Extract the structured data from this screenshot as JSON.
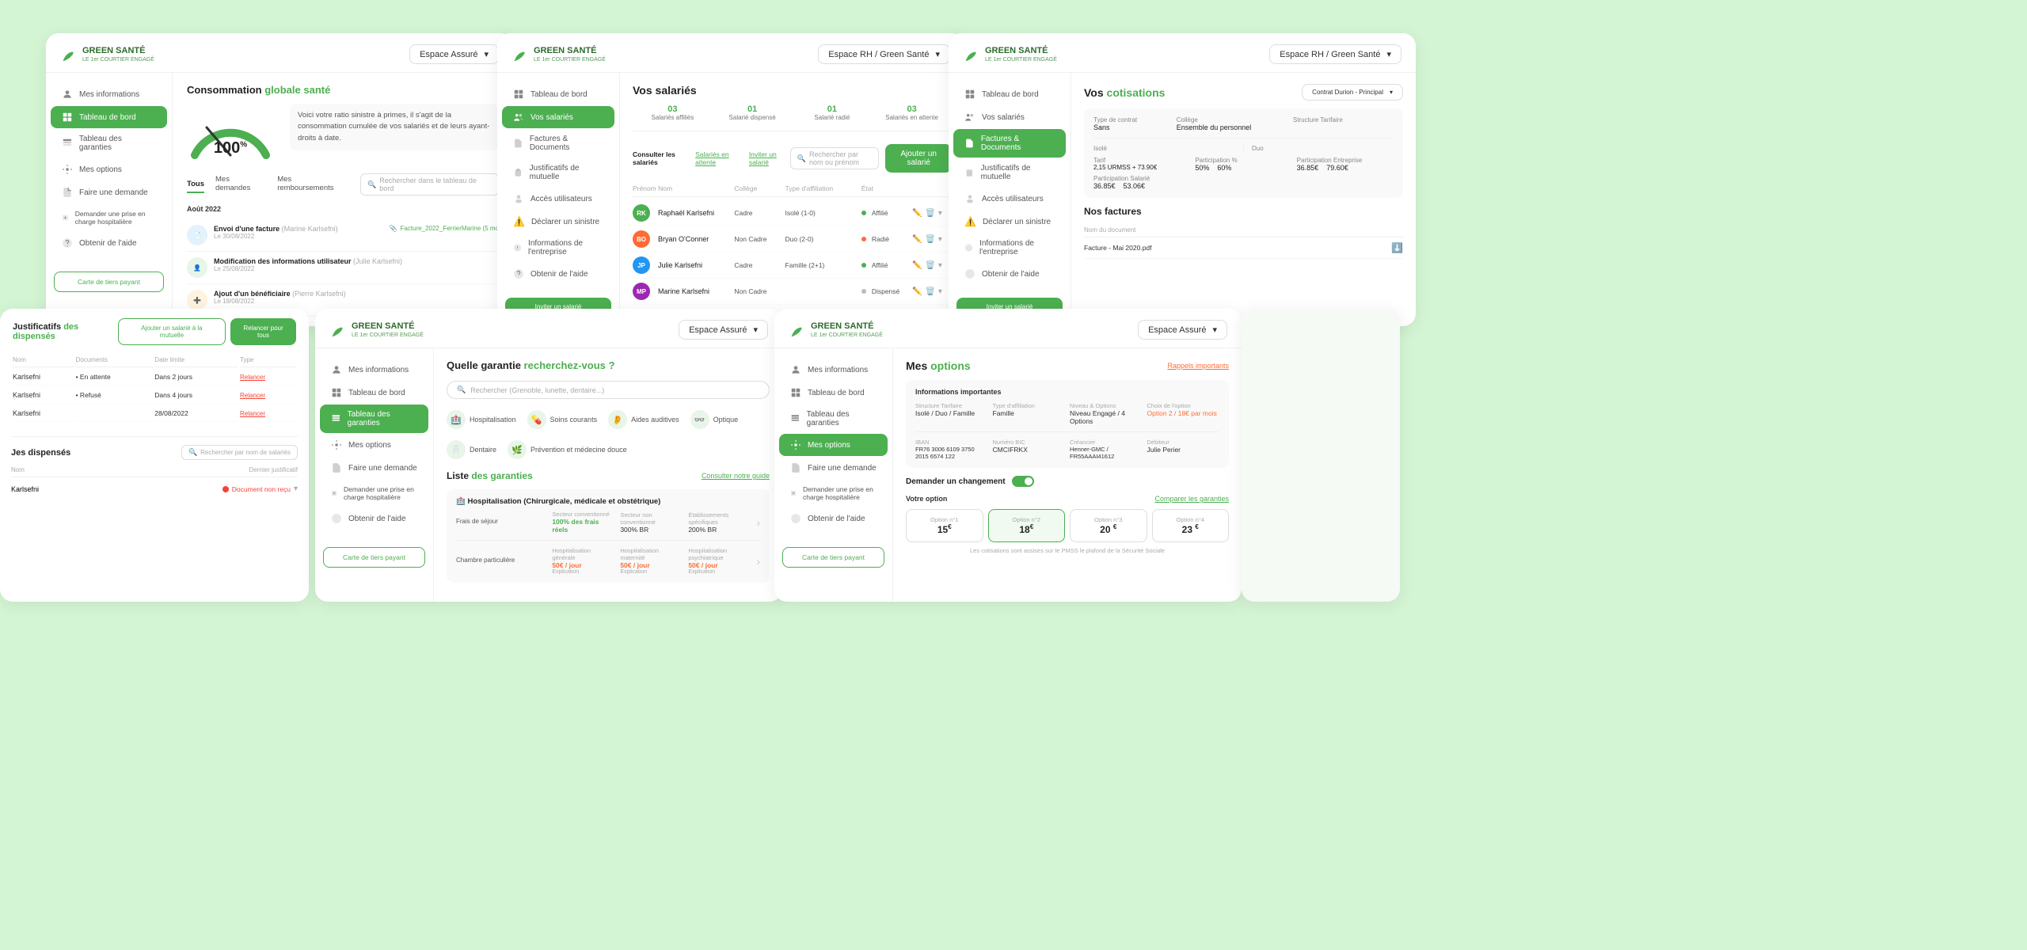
{
  "brand": {
    "name": "GREEN SANTÉ",
    "tagline": "LE 1er COURTIER ENGAGÉ"
  },
  "card1": {
    "title": "Consommation globale santé",
    "dropdownLabel": "Espace Assuré",
    "gaugePercent": "100",
    "gaugeUnit": "%",
    "gaugeDesc": "Voici votre ratio sinistre à primes, il s'agit de la consommation cumulée de vos salariés et de leurs ayant-droits à date.",
    "tabs": [
      "Tous",
      "Mes demandes",
      "Mes remboursements"
    ],
    "activeTab": "Tous",
    "searchPlaceholder": "Rechercher dans le tableau de bord",
    "monthLabel": "Août 2022",
    "activities": [
      {
        "type": "facture",
        "title": "Envoi d'une facture",
        "subtitle": "Marine Karlsefni",
        "date": "Le 30/08/2022",
        "badge": "Facture_2022_FerrierMarine (5 mo"
      },
      {
        "type": "modification",
        "title": "Modification des informations utilisateur",
        "subtitle": "Julie Karlsefni",
        "date": "Le 25/08/2022",
        "badge": ""
      },
      {
        "type": "ajout",
        "title": "Ajout d'un bénéficiaire",
        "subtitle": "Pierre Karlsefni",
        "date": "Le 18/08/2022",
        "badge": ""
      }
    ],
    "nav": [
      {
        "label": "Mes informations",
        "icon": "person",
        "active": false
      },
      {
        "label": "Tableau de bord",
        "icon": "dashboard",
        "active": true
      },
      {
        "label": "Tableau des garanties",
        "icon": "table",
        "active": false
      },
      {
        "label": "Mes options",
        "icon": "options",
        "active": false
      },
      {
        "label": "Faire une demande",
        "icon": "request",
        "active": false
      },
      {
        "label": "Demander une prise en charge hospitalière",
        "icon": "hospital",
        "active": false
      },
      {
        "label": "Obtenir de l'aide",
        "icon": "help",
        "active": false
      }
    ],
    "ctaLabel": "Carte de tiers payant"
  },
  "card2": {
    "dropdownLabel": "Espace RH / Green Santé",
    "pageTitle": "Vos salariés",
    "stats": [
      {
        "num": "03",
        "label": "Salariés affiliés"
      },
      {
        "num": "01",
        "label": "Salarié dispensé"
      },
      {
        "num": "01",
        "label": "Salarié radié"
      },
      {
        "num": "03",
        "label": "Salariés en attente"
      }
    ],
    "tabs": [
      "Consulter les salariés",
      "Salariés en attente",
      "Inviter un salarié"
    ],
    "searchPlaceholder": "Rechercher par nom ou prénom",
    "ctaLabel": "Ajouter un salarié",
    "tableHeaders": [
      "Prénom Nom",
      "Collège",
      "Type d'affiliation",
      "État"
    ],
    "salaries": [
      {
        "initials": "RK",
        "name": "Raphaël Karlsefni",
        "college": "Cadre",
        "affil": "Isolé (1-0)",
        "etat": "Affilié",
        "color": "#4caf50"
      },
      {
        "initials": "BO",
        "name": "Bryan O'Conner",
        "college": "Non Cadre",
        "affil": "Duo (2-0)",
        "etat": "Radié",
        "color": "#ff6b35"
      },
      {
        "initials": "JP",
        "name": "Julie Karlsefni",
        "college": "Cadre",
        "affil": "Famille (2+1)",
        "etat": "Affilié",
        "color": "#2196f3"
      },
      {
        "initials": "MP",
        "name": "Marine Karlsefni",
        "college": "Non Cadre",
        "affil": "",
        "etat": "Dispensé",
        "color": "#9c27b0"
      }
    ],
    "nav": [
      {
        "label": "Tableau de bord",
        "icon": "dashboard",
        "active": false
      },
      {
        "label": "Vos salariés",
        "icon": "people",
        "active": true
      },
      {
        "label": "Factures & Documents",
        "icon": "document",
        "active": false
      },
      {
        "label": "Justificatifs de mutuelle",
        "icon": "justif",
        "active": false
      },
      {
        "label": "Accès utilisateurs",
        "icon": "access",
        "active": false
      },
      {
        "label": "Déclarer un sinistre",
        "icon": "sinistre",
        "active": false
      },
      {
        "label": "Informations de l'entreprise",
        "icon": "info",
        "active": false
      },
      {
        "label": "Obtenir de l'aide",
        "icon": "help",
        "active": false
      }
    ],
    "ctaInvite": "Inviter un salarié"
  },
  "card3": {
    "dropdownLabel": "Espace RH / Green Santé",
    "pageTitle": "Vos cotisations",
    "dropdownContract": "Contrat Durion - Principal",
    "nav": [
      {
        "label": "Tableau de bord",
        "icon": "dashboard",
        "active": false
      },
      {
        "label": "Vos salariés",
        "icon": "people",
        "active": false
      },
      {
        "label": "Factures & Documents",
        "icon": "document",
        "active": true
      },
      {
        "label": "Justificatifs de mutuelle",
        "icon": "justif",
        "active": false
      },
      {
        "label": "Accès utilisateurs",
        "icon": "access",
        "active": false
      },
      {
        "label": "Déclarer un sinistre",
        "icon": "sinistre",
        "active": false
      },
      {
        "label": "Informations de l'entreprise",
        "icon": "info",
        "active": false
      },
      {
        "label": "Obtenir de l'aide",
        "icon": "help",
        "active": false
      }
    ],
    "cotisations": {
      "headers": [
        "Type de contrat",
        "Collège",
        "Structure Tarifaire"
      ],
      "rows": [
        {
          "typeContrat": "Sans",
          "college": "Ensemble du personnel",
          "structureTarif": ""
        }
      ],
      "details": {
        "isoleTarif": "2,15 URMSS + 73.90€",
        "duoTarif": "",
        "isoleLabel": "Isolé",
        "duoLabel": "Duo",
        "tarifLabel": "Tarif",
        "participLabel": "Participation %",
        "participEntreLabel": "Participation Entreprise",
        "participSalLabel": "Participation Salarié",
        "participIso": "50%",
        "participDuo": "60%",
        "partEntIso": "36.85€",
        "partEntDuo": "79.60€",
        "partSalIso": "36.85€",
        "partSalDuo": "53.06€"
      }
    },
    "factures": {
      "title": "Nos factures",
      "headers": [
        "Nom du document",
        ""
      ],
      "items": [
        {
          "name": "Facture - Mai 2020.pdf",
          "date": ""
        }
      ]
    },
    "ctaInvite": "Inviter un salarié"
  },
  "card4": {
    "breadcrumb": "Justificatifs des dispensés",
    "btns": [
      "Ajouter un salarié à la mutuelle",
      "Relancer pour tous"
    ],
    "tableHeaders": [
      "Nom",
      "Documents",
      "Date limite",
      "Type"
    ],
    "dispensesAttente": [
      {
        "nom": "Karlsefni",
        "documents": "En attente",
        "dateLimite": "Dans 2 jours",
        "type": "Relancer"
      },
      {
        "nom": "Karlsefni",
        "documents": "Refusé",
        "dateLimite": "Dans 4 jours",
        "type": "Relancer"
      },
      {
        "nom": "Karlsefni",
        "documents": "",
        "dateLimite": "28/08/2022",
        "type": "Relancer"
      }
    ],
    "dispensesTitle": "es dispensés",
    "dispensesSearch": "Rechercher par nom de salariés",
    "dispensesTable": {
      "headers": [
        "Nom",
        "Dernier justificatif"
      ],
      "rows": [
        {
          "nom": "Karlsefni",
          "justificatif": "Document non reçu"
        }
      ]
    }
  },
  "card5": {
    "dropdownLabel": "Espace Assuré",
    "pageTitle": "Quelle garantie recherchez-vous ?",
    "pageTitleHighlight": "recherchez-vous",
    "searchPlaceholder": "Rechercher (Grenoble, lunette, dentaire...)",
    "categories": [
      {
        "label": "Hospitalisation",
        "icon": "🏥"
      },
      {
        "label": "Soins courants",
        "icon": "💊"
      },
      {
        "label": "Aides auditives",
        "icon": "👂"
      },
      {
        "label": "Optique",
        "icon": "👓"
      },
      {
        "label": "Dentaire",
        "icon": "🦷"
      },
      {
        "label": "Prévention et médecine douce",
        "icon": "🌿"
      }
    ],
    "listTitle": "Liste des garanties",
    "guideLink": "Consulter notre guide",
    "garanties": [
      {
        "title": "Hospitalisation (Chirurgicale, médicale et obstétrique)",
        "rows": [
          {
            "label": "Frais de séjour",
            "cols": [
              {
                "header": "Secteur conventionné",
                "val": "100% des frais réels",
                "color": "green"
              },
              {
                "header": "Secteur non conventionné",
                "val": "300% BR",
                "color": ""
              },
              {
                "header": "Établissements spécifiques",
                "val": "200% BR",
                "color": ""
              }
            ]
          },
          {
            "label": "Chambre particulière",
            "cols": [
              {
                "header": "Hospitalisation générale",
                "val": "50€ / jour",
                "color": "orange"
              },
              {
                "header": "Hospitalisation maternité",
                "val": "50€ / jour",
                "color": "orange"
              },
              {
                "header": "Hospitalisation psychiatrique",
                "val": "50€ / jour",
                "color": "orange"
              }
            ]
          }
        ]
      }
    ],
    "nav": [
      {
        "label": "Mes informations",
        "icon": "person",
        "active": false
      },
      {
        "label": "Tableau de bord",
        "icon": "dashboard",
        "active": false
      },
      {
        "label": "Tableau des garanties",
        "icon": "table",
        "active": true
      },
      {
        "label": "Mes options",
        "icon": "options",
        "active": false
      },
      {
        "label": "Faire une demande",
        "icon": "request",
        "active": false
      },
      {
        "label": "Demander une prise en charge hospitalière",
        "icon": "hospital",
        "active": false
      },
      {
        "label": "Obtenir de l'aide",
        "icon": "help",
        "active": false
      }
    ],
    "ctaLabel": "Carte de tiers payant"
  },
  "card6": {
    "dropdownLabel": "Espace Assuré",
    "pageTitle": "Mes options",
    "rappelLink": "Rappels importants",
    "infoTitle": "Informations importantes",
    "infoFields": [
      {
        "label": "Structure Tarifaire",
        "val": "Isolé / Duo / Famille"
      },
      {
        "label": "Type d'affiliation",
        "val": "Famille"
      },
      {
        "label": "Niveau & Options",
        "val": "Niveau Engagé / 4 Options"
      },
      {
        "label": "Choix de l'option",
        "val": "Option 2 / 18€ par mois",
        "orange": true
      }
    ],
    "infoFields2": [
      {
        "label": "IBAN",
        "val": "FR76 3006 6109 3750 2015 6574 122"
      },
      {
        "label": "Numéro BIC",
        "val": "CMCIFRKX"
      },
      {
        "label": "Créancier",
        "val": "Henner-GMC / FR55AAAI41612"
      },
      {
        "label": "Débiteur",
        "val": "Julie Perier"
      }
    ],
    "changementLabel": "Demander un changement",
    "votrOptionLabel": "Votre option",
    "compareLabel": "Comparer les garanties",
    "options": [
      {
        "num": "Option n°1",
        "price": "15",
        "unit": "€",
        "selected": false
      },
      {
        "num": "Option n°2",
        "price": "18",
        "unit": "€",
        "selected": true
      },
      {
        "num": "Option n°3",
        "price": "20",
        "unit": "€",
        "selected": false
      },
      {
        "num": "Option n°4",
        "price": "23",
        "unit": "€",
        "selected": false
      }
    ],
    "cotisNote": "Les cotisations sont assises sur le PMSS le plafond de la Sécurité Sociale",
    "nav": [
      {
        "label": "Mes informations",
        "icon": "person",
        "active": false
      },
      {
        "label": "Tableau de bord",
        "icon": "dashboard",
        "active": false
      },
      {
        "label": "Tableau des garanties",
        "icon": "table",
        "active": false
      },
      {
        "label": "Mes options",
        "icon": "options",
        "active": true
      },
      {
        "label": "Faire une demande",
        "icon": "request",
        "active": false
      },
      {
        "label": "Demander une prise en charge hospitalière",
        "icon": "hospital",
        "active": false
      },
      {
        "label": "Obtenir de l'aide",
        "icon": "help",
        "active": false
      }
    ],
    "ctaLabel": "Carte de tiers payant"
  }
}
